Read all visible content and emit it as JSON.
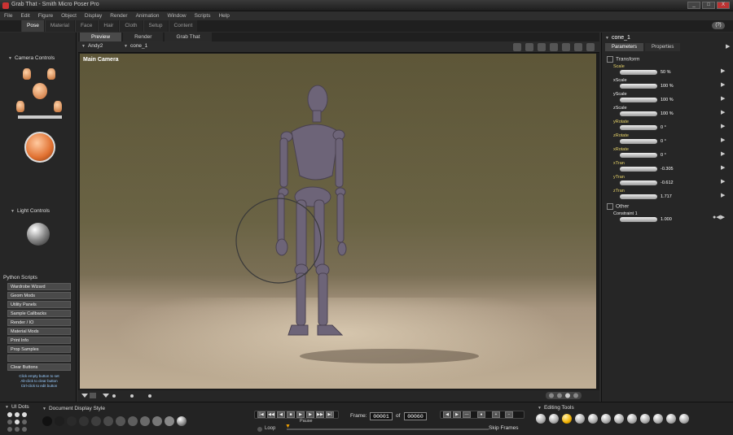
{
  "window": {
    "title": "Grab That - Smith Micro Poser Pro",
    "controls": [
      "_",
      "□",
      "X"
    ]
  },
  "menu": [
    "File",
    "Edit",
    "Figure",
    "Object",
    "Display",
    "Render",
    "Animation",
    "Window",
    "Scripts",
    "Help"
  ],
  "rooms": [
    "Pose",
    "Material",
    "Face",
    "Hair",
    "Cloth",
    "Setup",
    "Content"
  ],
  "active_room": "Pose",
  "help_button": "(?)",
  "left": {
    "camera_controls": "Camera Controls",
    "light_controls": "Light Controls",
    "python_scripts": "Python Scripts",
    "scripts": [
      "Wardrobe Wizard",
      "Geom Mods",
      "Utility Panels",
      "Sample Callbacks",
      "Render / IO",
      "Material Mods",
      "Print Info",
      "Prop Samples",
      "",
      "Clear Buttons"
    ],
    "note_lines": [
      "Click empty button to set",
      "Alt-click to clear button",
      "Ctrl-click to edit button"
    ]
  },
  "viewport": {
    "tabs": [
      "Preview",
      "Render",
      "Grab That"
    ],
    "figure_select": "Andy2",
    "actor_select": "cone_1",
    "camera_label": "Main Camera"
  },
  "params": {
    "title": "cone_1",
    "tabs": [
      "Parameters",
      "Properties"
    ],
    "transform_group": "Transform",
    "rows": [
      {
        "label": "Scale",
        "value": "50 %"
      },
      {
        "label": "xScale",
        "value": "100 %"
      },
      {
        "label": "yScale",
        "value": "100 %"
      },
      {
        "label": "zScale",
        "value": "100 %"
      },
      {
        "label": "yRotate",
        "value": "0 °"
      },
      {
        "label": "zRotate",
        "value": "0 °"
      },
      {
        "label": "xRotate",
        "value": "0 °"
      },
      {
        "label": "xTran",
        "value": "-0.305"
      },
      {
        "label": "yTran",
        "value": "-0.612"
      },
      {
        "label": "zTran",
        "value": "1.717"
      }
    ],
    "other_group": "Other",
    "other_rows": [
      {
        "label": "Constraint 1",
        "value": "1.000"
      }
    ]
  },
  "bottom": {
    "ui_dots": "UI Dots",
    "doc_display_style": "Document Display Style",
    "loop_label": "Loop",
    "pause_label": "Pause",
    "frame_label": "Frame:",
    "frame_current": "00001",
    "of_label": "of",
    "frame_total": "00060",
    "skip_frames": "Skip Frames",
    "editing_tools": "Editing Tools"
  }
}
